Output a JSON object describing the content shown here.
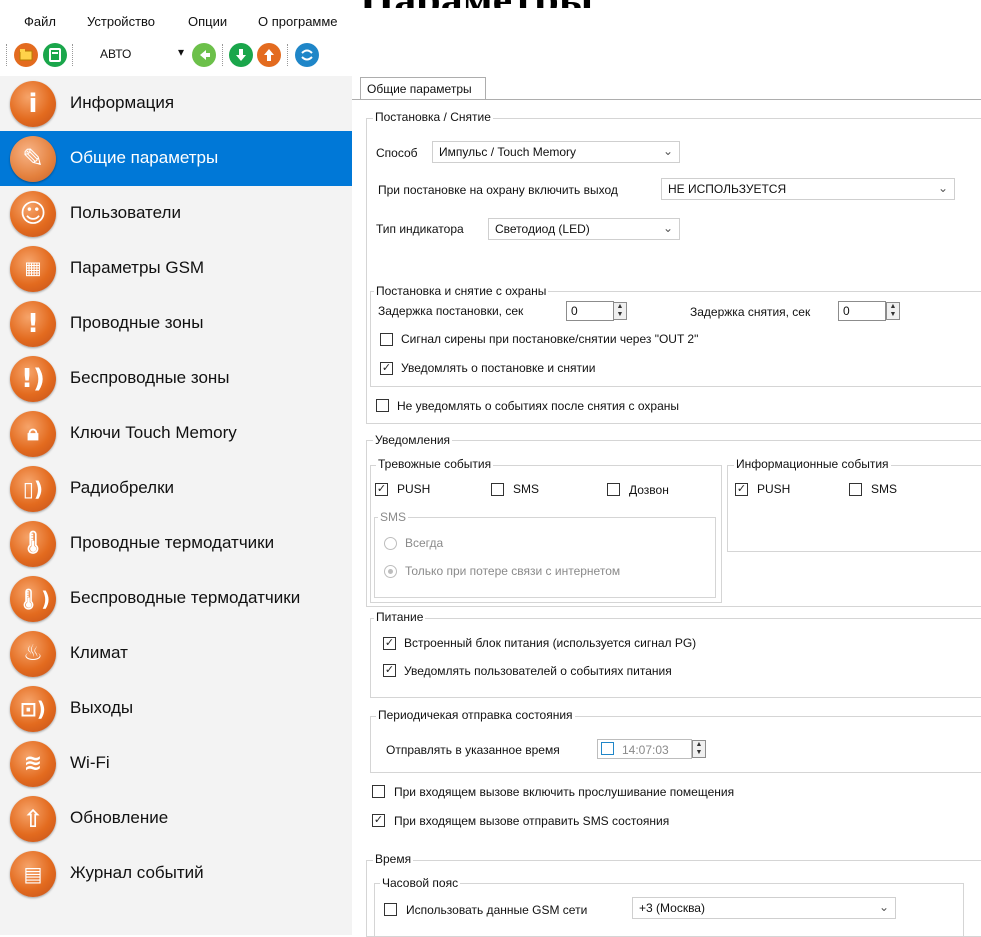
{
  "window": {
    "top_caption": "Параметры"
  },
  "menu": [
    "Файл",
    "Устройство",
    "Опции",
    "О программе"
  ],
  "toolbar": {
    "mode_value": "АВТО"
  },
  "sidebar": {
    "items": [
      {
        "label": "Информация",
        "icon": "info-icon"
      },
      {
        "label": "Общие параметры",
        "icon": "wrench-icon"
      },
      {
        "label": "Пользователи",
        "icon": "users-icon"
      },
      {
        "label": "Параметры GSM",
        "icon": "gsm-icon"
      },
      {
        "label": "Проводные зоны",
        "icon": "exclamation-icon"
      },
      {
        "label": "Беспроводные зоны",
        "icon": "wireless-exclamation-icon"
      },
      {
        "label": "Ключи Touch Memory",
        "icon": "lock-icon"
      },
      {
        "label": "Радиобрелки",
        "icon": "remote-icon"
      },
      {
        "label": "Проводные термодатчики",
        "icon": "thermometer-icon"
      },
      {
        "label": "Беспроводные термодатчики",
        "icon": "wireless-thermometer-icon"
      },
      {
        "label": "Климат",
        "icon": "flame-icon"
      },
      {
        "label": "Выходы",
        "icon": "output-icon"
      },
      {
        "label": "Wi-Fi",
        "icon": "wifi-icon"
      },
      {
        "label": "Обновление",
        "icon": "update-arrow-icon"
      },
      {
        "label": "Журнал событий",
        "icon": "log-icon"
      }
    ],
    "active_index": 1
  },
  "tab": {
    "label": "Общие параметры"
  },
  "arming": {
    "title": "Постановка / Снятие",
    "method_label": "Способ",
    "method_value": "Импульс / Touch Memory",
    "output_label": "При постановке на охрану включить выход",
    "output_value": "НЕ ИСПОЛЬЗУЕТСЯ",
    "indicator_label": "Тип индикатора",
    "indicator_value": "Светодиод (LED)",
    "sub": {
      "title": "Постановка и снятие с охраны",
      "arm_delay_label": "Задержка постановки, сек",
      "arm_delay_value": "0",
      "disarm_delay_label": "Задержка снятия, сек",
      "disarm_delay_value": "0",
      "siren_label": "Сигнал сирены при постановке/снятии через \"OUT 2\"",
      "siren_checked": false,
      "notify_label": "Уведомлять о постановке и снятии",
      "notify_checked": true
    },
    "no_notify_label": "Не уведомлять о событиях после снятия с охраны",
    "no_notify_checked": false
  },
  "notifications": {
    "title": "Уведомления",
    "alarm": {
      "title": "Тревожные события",
      "push": "PUSH",
      "push_checked": true,
      "sms": "SMS",
      "sms_checked": false,
      "call": "Дозвон",
      "call_checked": false,
      "sms_group": {
        "title": "SMS",
        "always": "Всегда",
        "lost_internet": "Только при потере связи с интернетом",
        "selected": "lost_internet"
      }
    },
    "info": {
      "title": "Информационные события",
      "push": "PUSH",
      "push_checked": true,
      "sms": "SMS",
      "sms_checked": false
    }
  },
  "power": {
    "title": "Питание",
    "builtin_label": "Встроенный блок питания (используется сигнал PG)",
    "builtin_checked": true,
    "notify_label": "Уведомлять пользователей о событиях питания",
    "notify_checked": true
  },
  "periodic": {
    "title": "Периодичекая отправка состояния",
    "send_label": "Отправлять в указанное время",
    "send_checked": false,
    "time_value": "14:07:03"
  },
  "incoming": {
    "listen_label": "При входящем вызове включить прослушивание помещения",
    "listen_checked": false,
    "sms_label": "При входящем вызове отправить SMS состояния",
    "sms_checked": true
  },
  "time": {
    "title": "Время",
    "tz_title": "Часовой пояс",
    "gsm_label": "Использовать данные GSM сети",
    "gsm_checked": false,
    "tz_value": "+3 (Москва)"
  },
  "colors": {
    "accent": "#0078d7",
    "icon_orange": "#e36b1f",
    "sidebar_bg": "#f3f3f3"
  }
}
